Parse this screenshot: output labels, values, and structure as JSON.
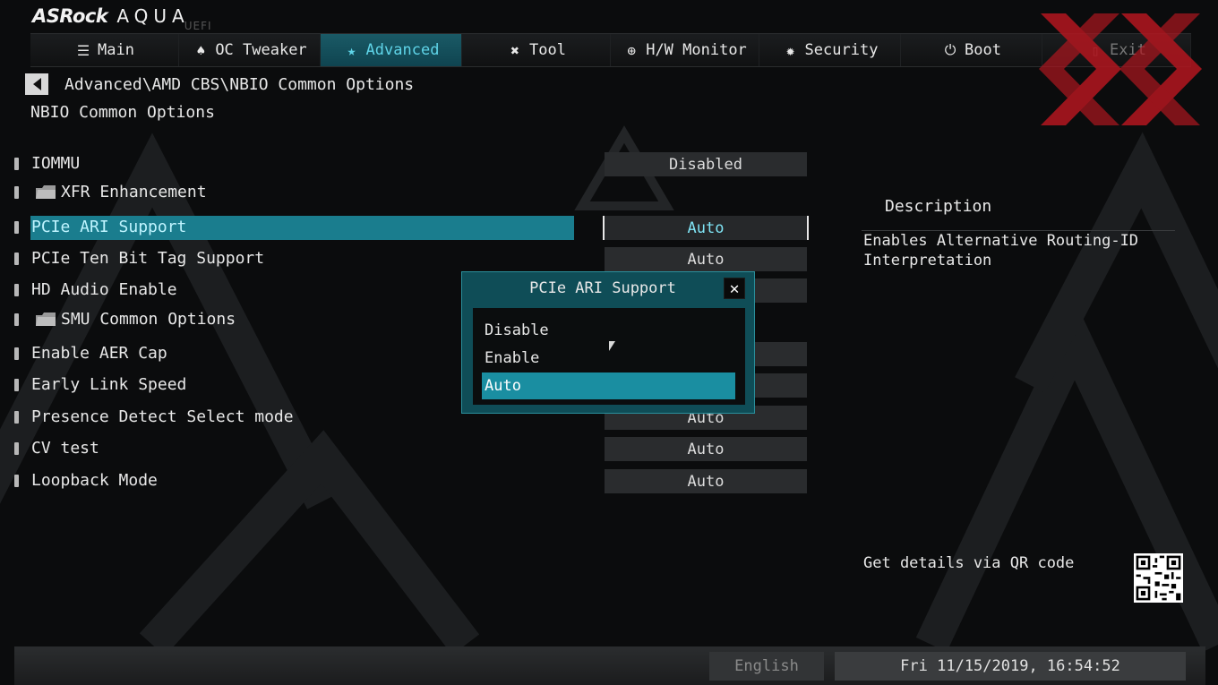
{
  "brand": {
    "name": "ASRock",
    "product": "AQUA",
    "sub": "UEFI"
  },
  "nav": [
    {
      "label": "Main",
      "icon": "list-icon"
    },
    {
      "label": "OC Tweaker",
      "icon": "rocket-icon"
    },
    {
      "label": "Advanced",
      "icon": "star-icon",
      "active": true
    },
    {
      "label": "Tool",
      "icon": "tools-icon"
    },
    {
      "label": "H/W Monitor",
      "icon": "crosshair-icon"
    },
    {
      "label": "Security",
      "icon": "shield-icon"
    },
    {
      "label": "Boot",
      "icon": "power-icon"
    },
    {
      "label": "Exit",
      "icon": "exit-icon"
    }
  ],
  "breadcrumb": "Advanced\\AMD CBS\\NBIO Common Options",
  "page_title": "NBIO Common Options",
  "items": [
    {
      "label": "IOMMU",
      "value": "Disabled"
    },
    {
      "label": "XFR Enhancement",
      "folder": true
    },
    {
      "label": "PCIe ARI Support",
      "value": "Auto",
      "selected": true
    },
    {
      "label": "PCIe Ten Bit Tag Support",
      "value": "Auto"
    },
    {
      "label": "HD Audio Enable",
      "value": "Auto"
    },
    {
      "label": "SMU Common Options",
      "folder": true
    },
    {
      "label": "Enable AER Cap",
      "value": ""
    },
    {
      "label": "Early Link Speed",
      "value": ""
    },
    {
      "label": "Presence Detect Select mode",
      "value": "Auto"
    },
    {
      "label": "CV test",
      "value": "Auto"
    },
    {
      "label": "Loopback Mode",
      "value": "Auto"
    }
  ],
  "description": {
    "title": "Description",
    "text": "Enables Alternative Routing-ID Interpretation"
  },
  "qr_label": "Get details via QR code",
  "popup": {
    "title": "PCIe ARI Support",
    "close": "✕",
    "options": [
      "Disable",
      "Enable",
      "Auto"
    ],
    "selected": "Auto"
  },
  "status": {
    "language": "English",
    "datetime": "Fri 11/15/2019, 16:54:52"
  }
}
